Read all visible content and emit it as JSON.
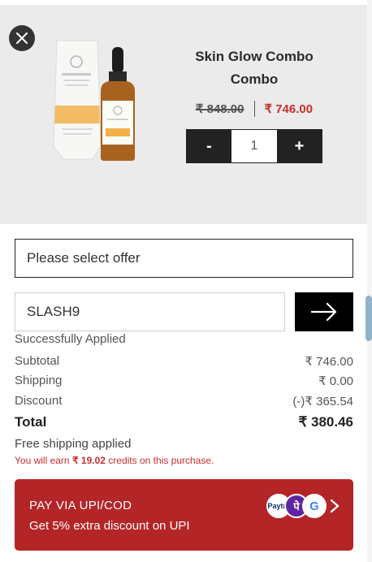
{
  "product": {
    "name": "Skin Glow Combo Combo",
    "price_original": "₹ 848.00",
    "price_sale": "₹ 746.00",
    "quantity": "1",
    "qty_minus": "-",
    "qty_plus": "+"
  },
  "offer": {
    "select_placeholder": "Please select offer"
  },
  "coupon": {
    "code": "SLASH9",
    "status": "Successfully Applied"
  },
  "summary": {
    "subtotal_label": "Subtotal",
    "subtotal_value": "₹ 746.00",
    "shipping_label": "Shipping",
    "shipping_value": "₹ 0.00",
    "discount_label": "Discount",
    "discount_value": "(-)₹ 365.54",
    "total_label": "Total",
    "total_value": "₹ 380.46"
  },
  "free_shipping": "Free shipping applied",
  "credits": {
    "prefix": "You will earn",
    "amount": "₹ 19.02",
    "suffix": "credits on this purchase."
  },
  "pay_button": {
    "line1": "PAY VIA UPI/COD",
    "line2": "Get 5% extra discount on UPI",
    "icons": [
      "paytm-icon",
      "phonepe-icon",
      "google-pay-icon",
      "chevron-right-icon"
    ],
    "paytm_text": "Paytm",
    "phonepe_text": "पे",
    "gpay_text": "G"
  },
  "colors": {
    "accent": "#b42528",
    "sale_price": "#c4302b",
    "dark": "#222222",
    "panel": "#ebebeb"
  }
}
